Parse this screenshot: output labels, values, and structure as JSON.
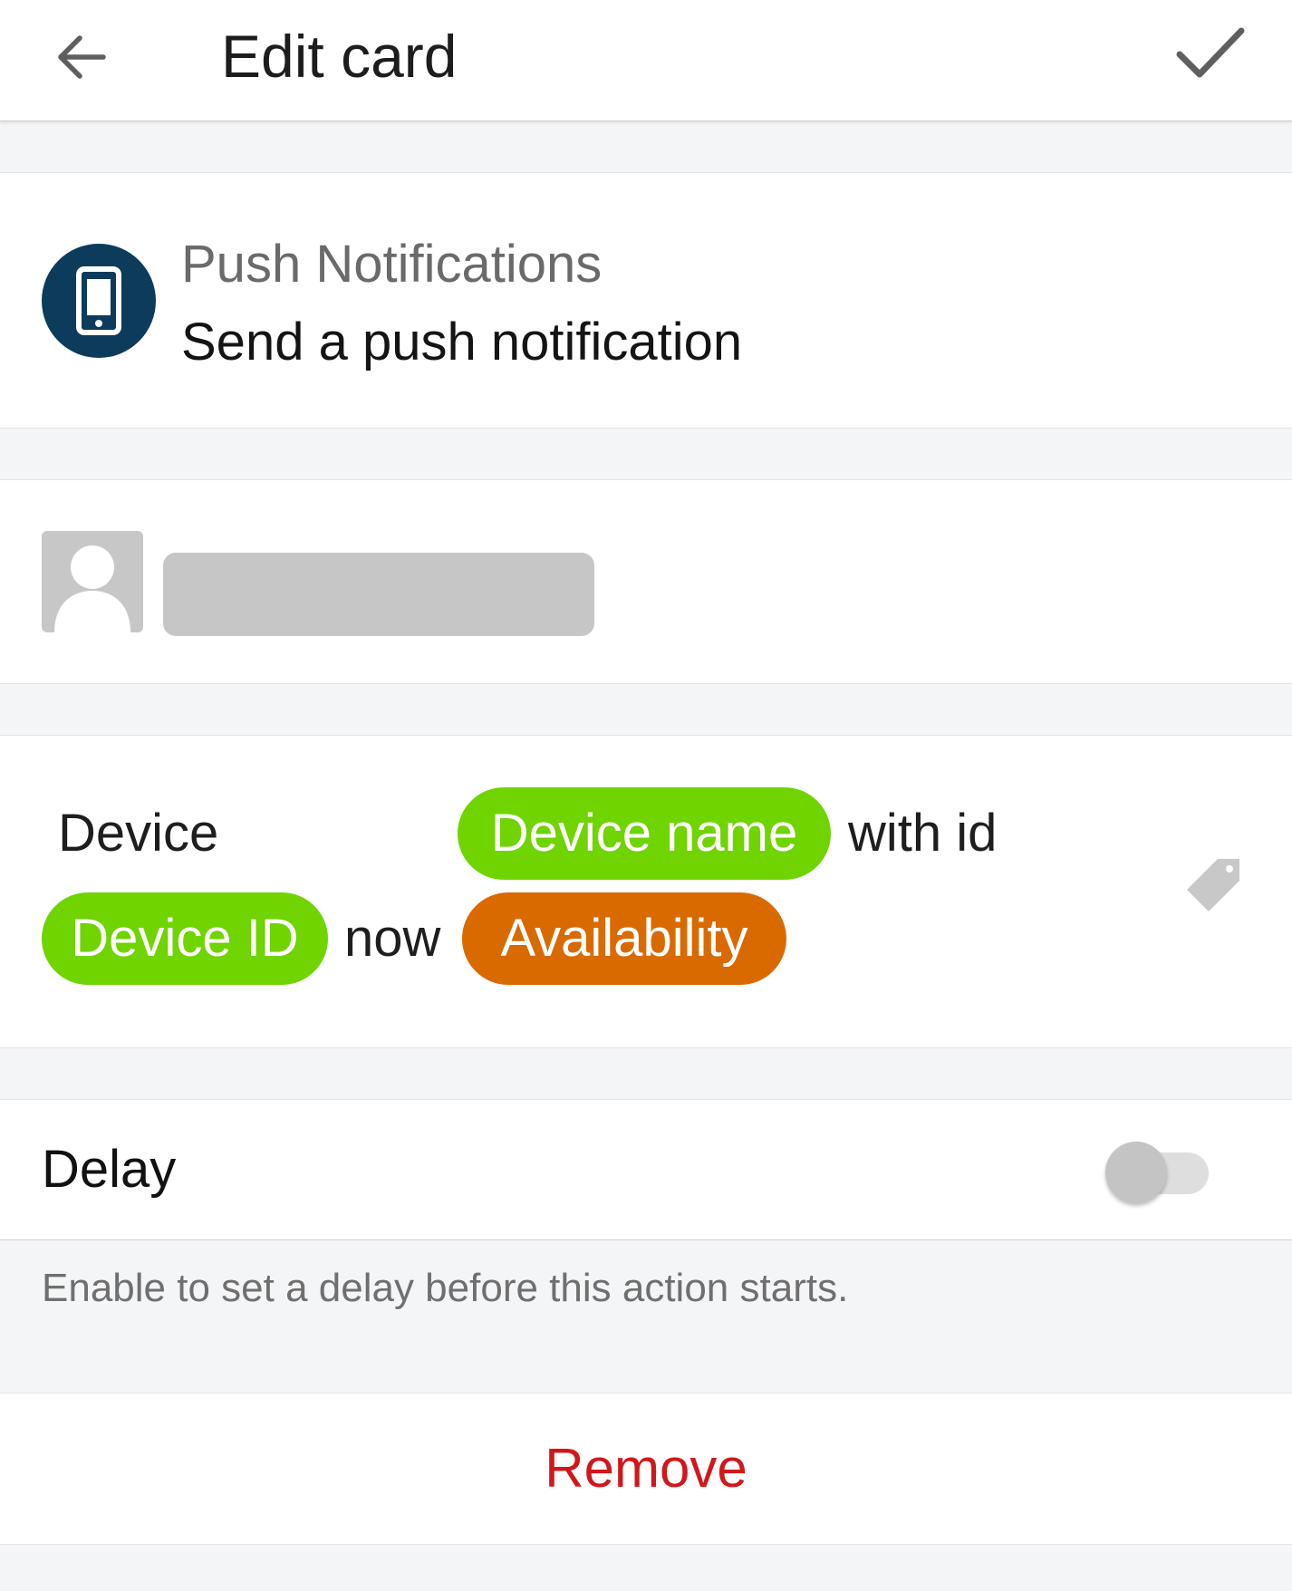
{
  "header": {
    "title": "Edit card",
    "back_icon": "arrow-left-icon",
    "confirm_icon": "check-icon"
  },
  "card": {
    "app_name": "Push Notifications",
    "action_name": "Send a push notification",
    "icon": "smartphone-icon",
    "icon_bg_color": "#0c3b5c"
  },
  "user": {
    "avatar_icon": "user-avatar-icon",
    "name_redacted": true
  },
  "message": {
    "word_device": "Device",
    "token_device_name": "Device name",
    "word_with_id": "with id",
    "token_device_id": "Device ID",
    "word_now": "now",
    "token_availability": "Availability",
    "token_green_color": "#6fd400",
    "token_orange_color": "#d96a00",
    "tag_icon": "tag-icon"
  },
  "delay": {
    "label": "Delay",
    "enabled": false,
    "hint": "Enable to set a delay before this action starts."
  },
  "remove": {
    "label": "Remove",
    "color": "#d0181c"
  }
}
